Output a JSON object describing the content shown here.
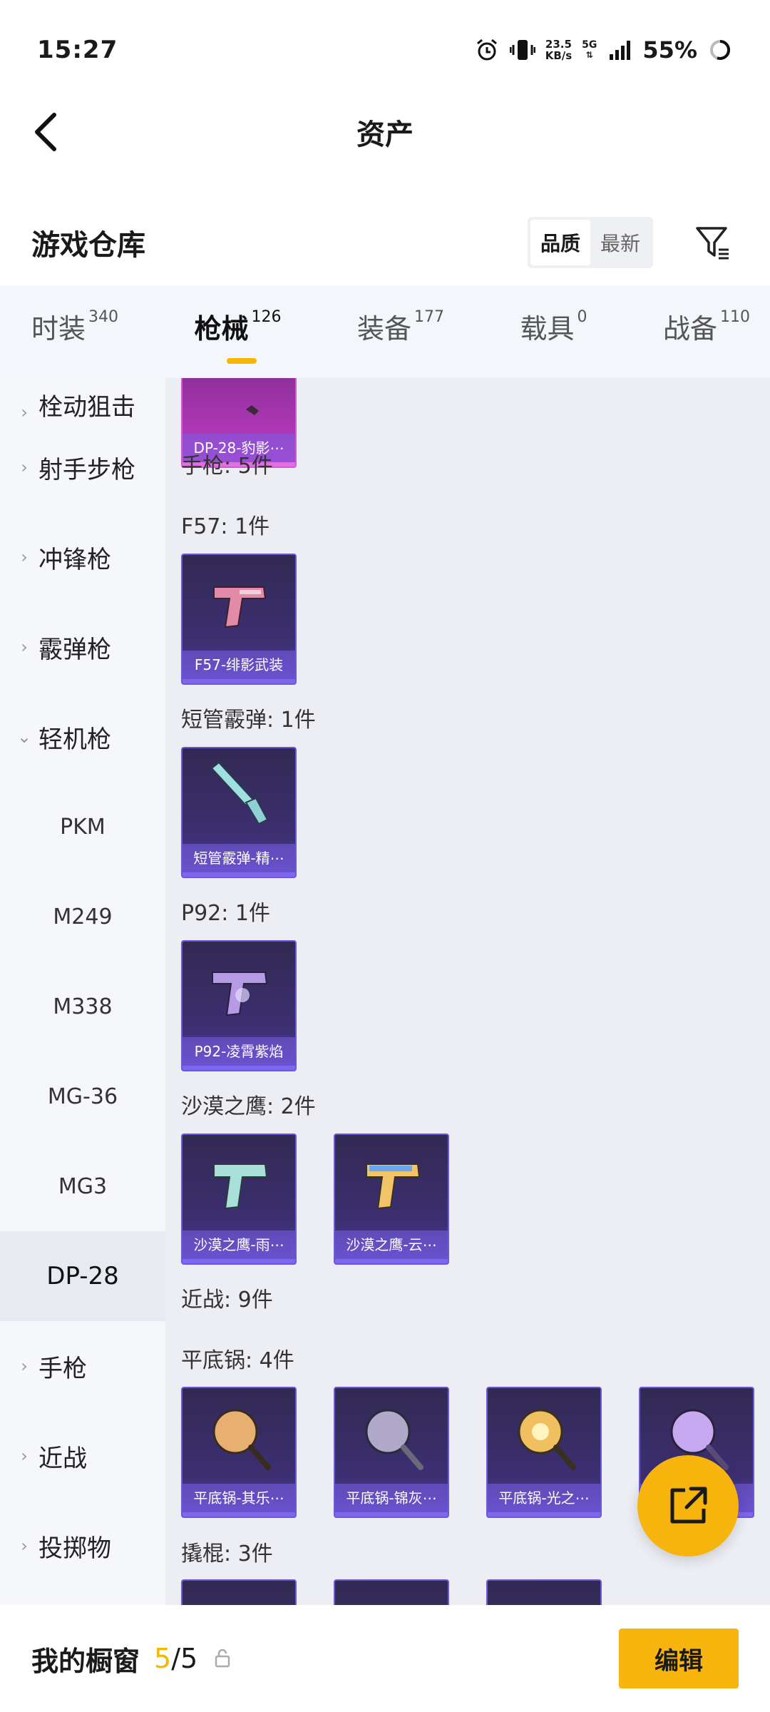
{
  "status_bar": {
    "time": "15:27",
    "net_speed_value": "23.5",
    "net_speed_unit": "KB/s",
    "network": "5G",
    "battery": "55%"
  },
  "nav": {
    "title": "资产"
  },
  "warehouse": {
    "title": "游戏仓库",
    "sort_options": [
      "品质",
      "最新"
    ],
    "sort_selected": "品质"
  },
  "tabs": [
    {
      "label": "时装",
      "count": "340"
    },
    {
      "label": "枪械",
      "count": "126",
      "active": true
    },
    {
      "label": "装备",
      "count": "177"
    },
    {
      "label": "载具",
      "count": "0"
    },
    {
      "label": "战备",
      "count": "110"
    }
  ],
  "sidebar": {
    "categories": [
      "栓动狙击",
      "射手步枪",
      "冲锋枪",
      "霰弹枪",
      "轻机枪"
    ],
    "lmg_sub": [
      "PKM",
      "M249",
      "M338",
      "MG-36",
      "MG3",
      "DP-28"
    ],
    "selected_sub": "DP-28",
    "more_categories": [
      "手枪",
      "近战",
      "投掷物"
    ]
  },
  "content": {
    "top_card": "DP-28-豹影⋯",
    "pistol_label": "手枪: 5件",
    "f57_label": "F57: 1件",
    "f57_card": "F57-绯影武装",
    "short_shotgun_label": "短管霰弹: 1件",
    "short_shotgun_card": "短管霰弹-精⋯",
    "p92_label": "P92: 1件",
    "p92_card": "P92-凌霄紫焰",
    "deagle_label": "沙漠之鹰: 2件",
    "deagle_cards": [
      "沙漠之鹰-雨⋯",
      "沙漠之鹰-云⋯"
    ],
    "melee_label": "近战: 9件",
    "pan_label": "平底锅: 4件",
    "pan_cards": [
      "平底锅-其乐⋯",
      "平底锅-锦灰⋯",
      "平底锅-光之⋯",
      "⋯"
    ],
    "crowbar_label": "撬棍: 3件"
  },
  "bottom_bar": {
    "title": "我的橱窗",
    "count_current": "5",
    "count_total": "/5",
    "edit_label": "编辑"
  },
  "colors": {
    "accent": "#f6b40d",
    "card_purple": "#3d2f74",
    "card_pink": "#c23bc6"
  }
}
